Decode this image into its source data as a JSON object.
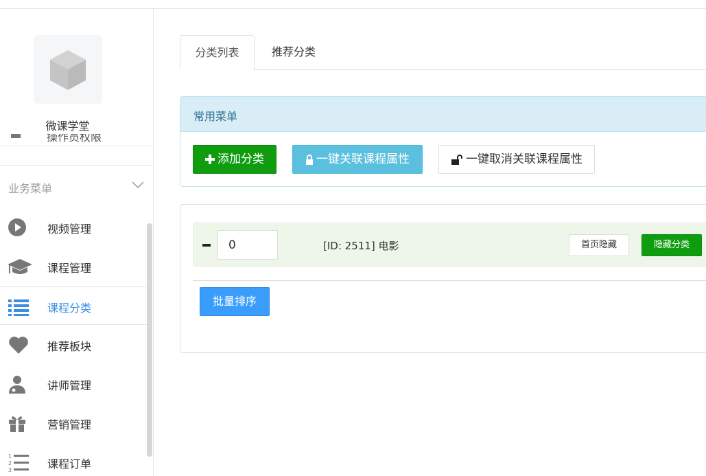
{
  "sidebar": {
    "site_name": "微课学堂",
    "partial_item": "操作员权限",
    "group_title": "业务菜单",
    "items": [
      {
        "label": "视频管理",
        "icon": "play-circle-icon"
      },
      {
        "label": "课程管理",
        "icon": "graduation-cap-icon"
      },
      {
        "label": "课程分类",
        "icon": "list-icon",
        "active": true
      },
      {
        "label": "推荐板块",
        "icon": "heart-icon"
      },
      {
        "label": "讲师管理",
        "icon": "user-md-icon"
      },
      {
        "label": "营销管理",
        "icon": "gift-icon"
      },
      {
        "label": "课程订单",
        "icon": "ordered-list-icon"
      }
    ]
  },
  "tabs": [
    {
      "label": "分类列表",
      "active": true
    },
    {
      "label": "推荐分类",
      "active": false
    }
  ],
  "common_menu": {
    "title": "常用菜单",
    "add_label": "添加分类",
    "link_label": "一键关联课程属性",
    "unlink_label": "一键取消关联课程属性"
  },
  "category_row": {
    "sort_value": "0",
    "name": "[ID: 2511] 电影",
    "home_hide_label": "首页隐藏",
    "hide_label": "隐藏分类"
  },
  "batch_sort_label": "批量排序",
  "colors": {
    "accent": "#3a8ee6",
    "success": "#0f9d0f",
    "info": "#5bc0de",
    "primary": "#3a9dfc",
    "panel_head": "#d9edf7"
  }
}
